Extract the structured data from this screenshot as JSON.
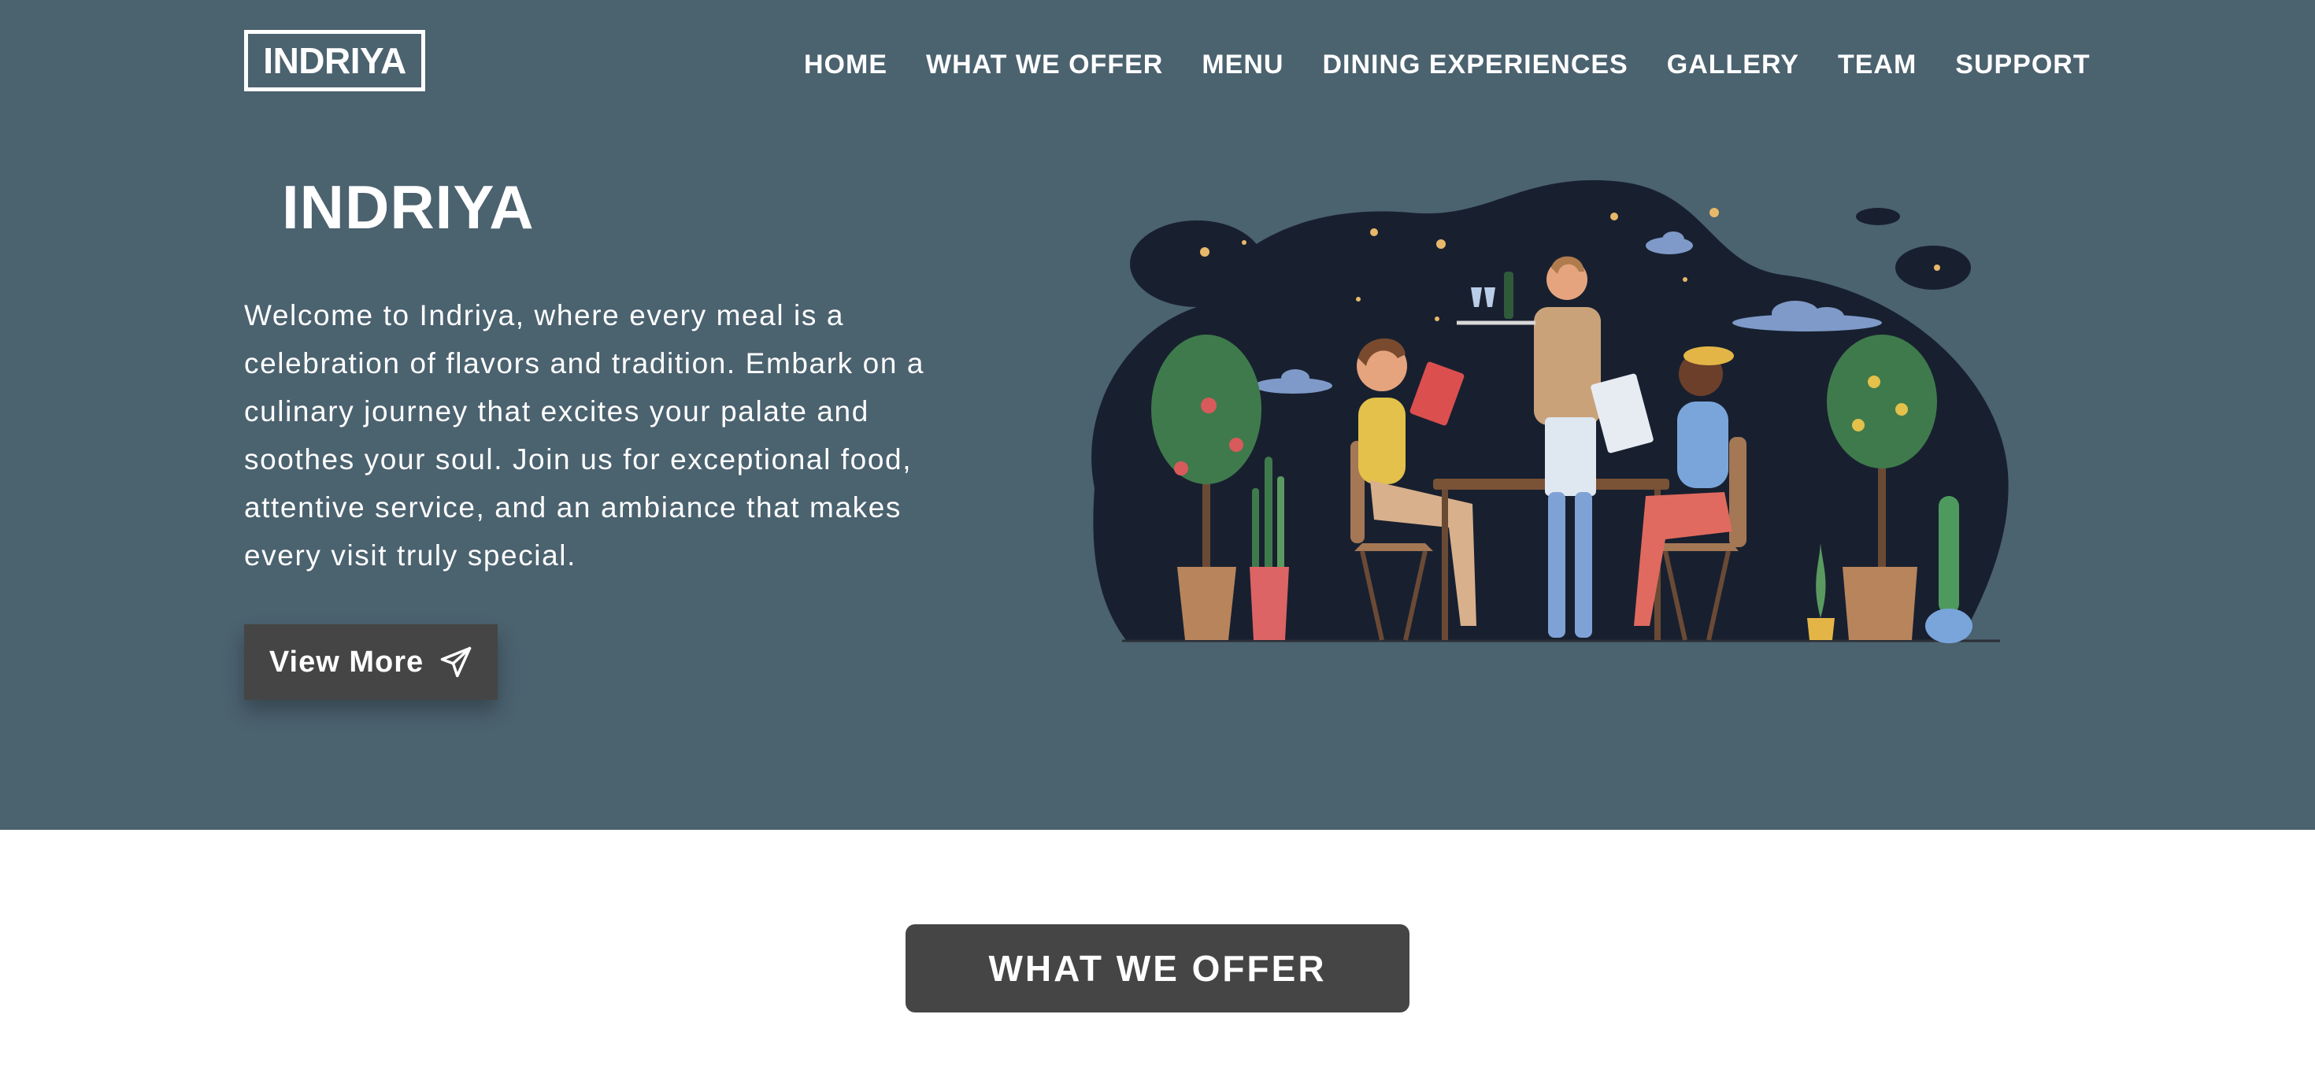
{
  "header": {
    "logo": "INDRIYA",
    "nav": [
      "HOME",
      "WHAT WE OFFER",
      "MENU",
      "DINING EXPERIENCES",
      "GALLERY",
      "TEAM",
      "SUPPORT"
    ]
  },
  "hero": {
    "title": "INDRIYA",
    "description": "Welcome to Indriya, where every meal is a celebration of flavors and tradition. Embark on a culinary journey that excites your palate and soothes your soul. Join us for exceptional food, attentive service, and an ambiance that makes every visit truly special.",
    "button_label": "View More",
    "button_icon": "paper-plane-icon"
  },
  "illustration": {
    "subject": "restaurant-dining-illustration"
  },
  "section": {
    "button_label": "WHAT WE OFFER"
  },
  "colors": {
    "hero_background": "#4b626f",
    "button_background": "#454545",
    "page_background": "#ffffff",
    "text_light": "#ffffff"
  }
}
